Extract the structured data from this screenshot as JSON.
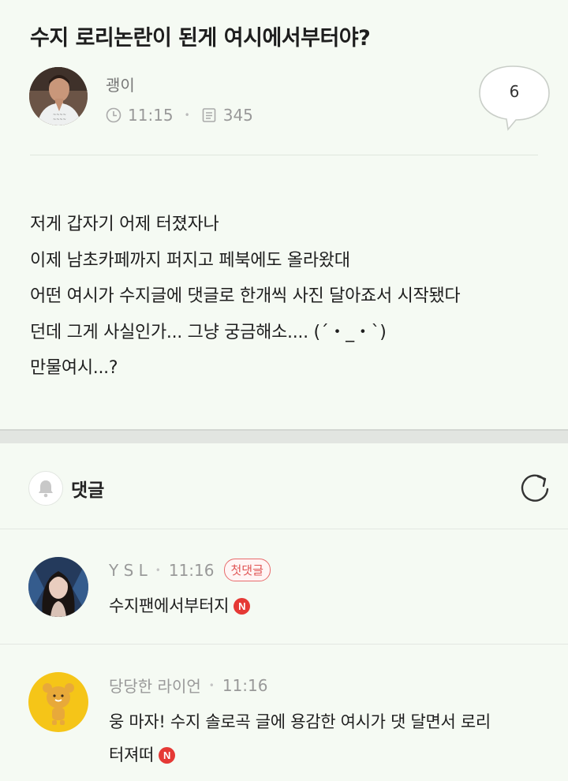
{
  "post": {
    "title": "수지 로리논란이 된게 여시에서부터야?",
    "author": "괭이",
    "time": "11:15",
    "views": "345",
    "comment_count": "6",
    "body_lines": [
      "저게 갑자기 어제 터졌자나",
      "이제 남초카페까지 퍼지고 페북에도 올라왔대",
      "어떤 여시가 수지글에 댓글로 한개씩 사진 달아죠서 시작됐다",
      "던데 그게 사실인가... 그냥 궁금해소.... (´・_・`)",
      "만물여시...?"
    ]
  },
  "comments_section": {
    "label": "댓글"
  },
  "comments": [
    {
      "author": "Y S L",
      "time": "11:16",
      "badge": "첫댓글",
      "text": "수지팬에서부터지",
      "new_badge": "N"
    },
    {
      "author": "당당한 라이언",
      "time": "11:16",
      "text_lines": [
        "웅 마자! 수지 솔로곡 글에 용감한 여시가 댓 달면서 로리",
        "터져떠"
      ],
      "new_badge": "N"
    }
  ],
  "icons": {
    "clock": "clock-icon",
    "document": "document-icon",
    "speech_bubble": "speech-bubble-icon",
    "bell": "bell-icon",
    "refresh": "refresh-icon",
    "new": "new-badge-icon"
  },
  "colors": {
    "background": "#f5faf3",
    "badge_red": "#e53935",
    "first_badge": "#e05555"
  }
}
